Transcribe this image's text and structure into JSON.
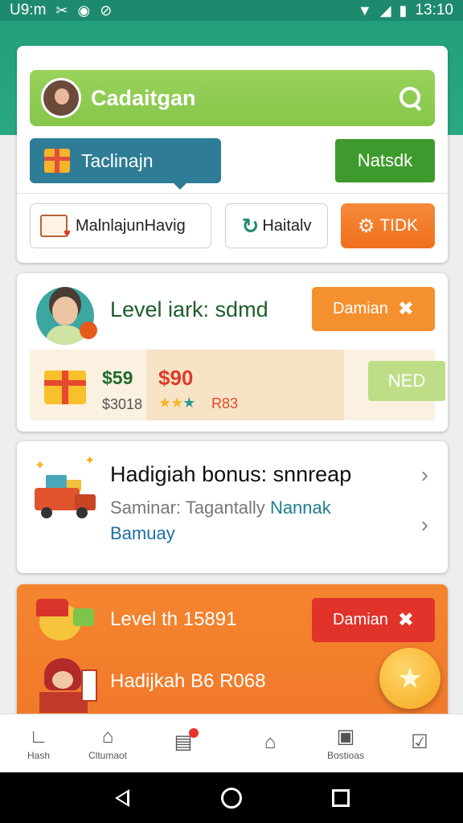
{
  "status_bar": {
    "carrier": "U9:m",
    "time": "13:10",
    "icons": [
      "tools-icon",
      "record-icon",
      "navigation-icon",
      "wifi-icon",
      "signal-icon",
      "battery-icon"
    ]
  },
  "search": {
    "label": "Cadaitgan"
  },
  "tabs": {
    "active_label": "Taclinajn",
    "right_button": "Natsdk"
  },
  "pills": {
    "first": "MalnlajunHavig",
    "second": "Haitalv",
    "third": "TIDK"
  },
  "level_card": {
    "title": "Level iark: sdmd",
    "button": "Damian",
    "price_a": "$59",
    "price_a_sub": "$3018",
    "price_b": "$90",
    "stars_label": "R83",
    "side_button": "NED"
  },
  "bonus_card": {
    "title": "Hadigiah bonus: snnreap",
    "subtitle_plain": "Saminar: Tagantally ",
    "subtitle_accent": "Nannak",
    "link": "Bamuay"
  },
  "promo_card": {
    "title": "Level th 15891",
    "subtitle": "Hadijkah B6 R068",
    "button": "Damian"
  },
  "bottom_nav": [
    {
      "label": "Hash",
      "icon": "home-corner-icon"
    },
    {
      "label": "Cltumaot",
      "icon": "house-icon"
    },
    {
      "label": "",
      "icon": "inbox-icon"
    },
    {
      "label": "",
      "icon": "home-icon"
    },
    {
      "label": "Bostioas",
      "icon": "briefcase-icon"
    },
    {
      "label": "",
      "icon": "edit-icon"
    }
  ],
  "colors": {
    "status_bar": "#1d8a6e",
    "search_bg": "#8ccb50",
    "tab_active": "#2e7c95",
    "accent_green": "#3f9a2d",
    "accent_orange": "#f5902f",
    "promo_bg": "#f4852f",
    "danger": "#e2332a"
  }
}
